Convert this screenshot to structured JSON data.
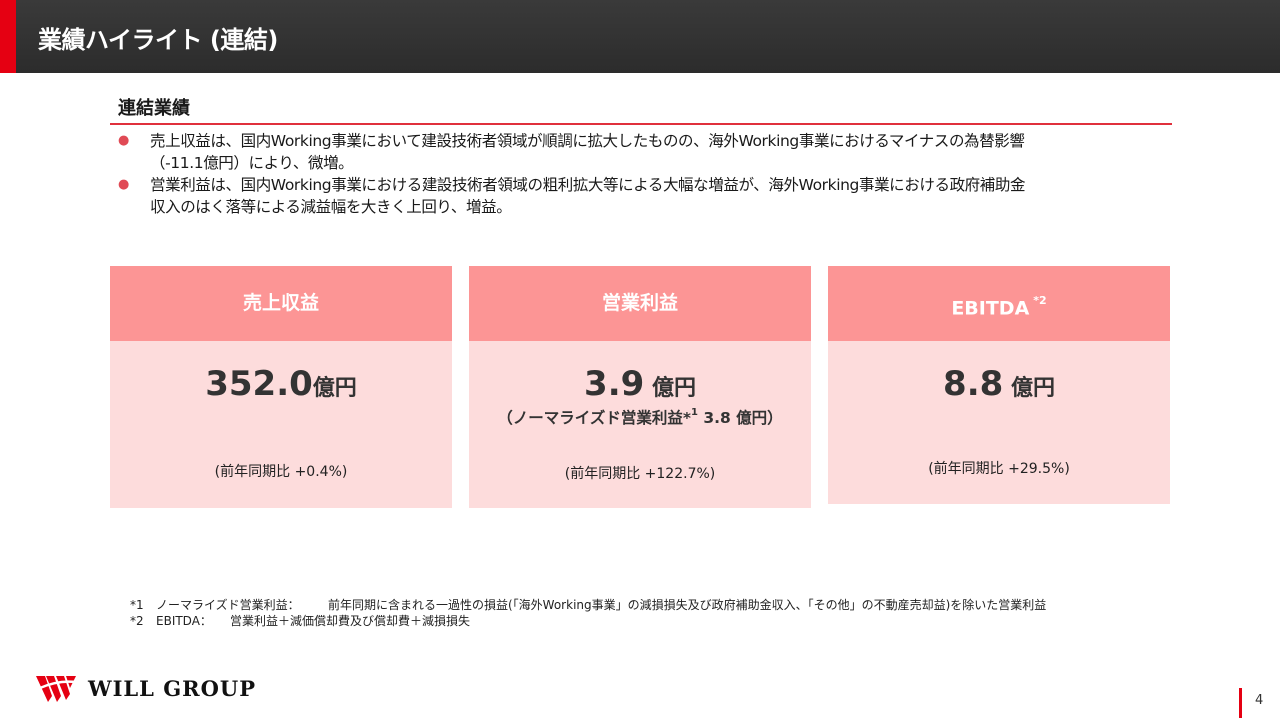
{
  "header": {
    "title": "業績ハイライト (連結)"
  },
  "section": {
    "title": "連結業績",
    "bullets": [
      {
        "line1": "売上収益は、国内Working事業において建設技術者領域が順調に拡大したものの、海外Working事業におけるマイナスの為替影響",
        "line2": "（-11.1億円）により、微増。"
      },
      {
        "line1": "営業利益は、国内Working事業における建設技術者領域の粗利拡大等による大幅な増益が、海外Working事業における政府補助金",
        "line2": "収入のはく落等による減益幅を大きく上回り、増益。"
      }
    ]
  },
  "cards": [
    {
      "title": "売上収益",
      "value": "352.0",
      "unit": "億円",
      "yoy": "(前年同期比 +0.4%)"
    },
    {
      "title": "営業利益",
      "value": "3.9",
      "unit": " 億円",
      "note_pre": "（ノーマライズド営業利益*",
      "note_sup": "1",
      "note_post": " 3.8 億円）",
      "yoy": "(前年同期比 +122.7%)"
    },
    {
      "title": "EBITDA",
      "title_sup": "*2",
      "value": "8.8",
      "unit": " 億円",
      "yoy": "(前年同期比 +29.5%)"
    }
  ],
  "footnotes": [
    {
      "mark": "*1",
      "label": "ノーマライズド営業利益：",
      "text": "前年同期に含まれる一過性の損益(「海外Working事業」の減損損失及び政府補助金収入、「その他」の不動産売却益)を除いた営業利益"
    },
    {
      "mark": "*2",
      "label": "EBITDA：",
      "text": "営業利益＋減価償却費及び償却費＋減損損失"
    }
  ],
  "brand": {
    "name": "WILL GROUP",
    "accent_color": "#e50012"
  },
  "page": {
    "number": "4"
  },
  "colors": {
    "card_header": "#fc9595",
    "card_body": "#fddcdc",
    "header_bar": "#333333",
    "rule": "#e0303c"
  }
}
